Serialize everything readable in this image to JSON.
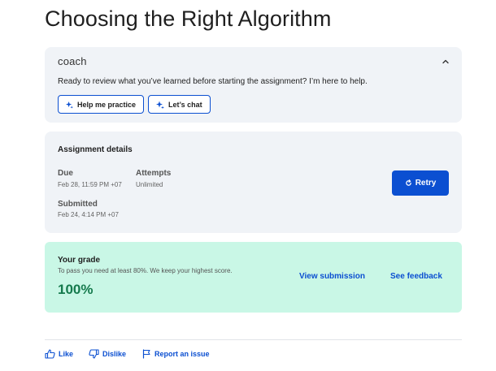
{
  "page": {
    "title": "Choosing the Right Algorithm"
  },
  "coach": {
    "title": "coach",
    "collapse_icon": "chevron-up-icon",
    "description": "Ready to review what you’ve learned before starting the assignment? I’m here to help.",
    "buttons": [
      {
        "label": "Help me practice",
        "icon": "sparkle-icon"
      },
      {
        "label": "Let’s chat",
        "icon": "sparkle-icon"
      }
    ]
  },
  "assignment": {
    "title": "Assignment details",
    "due_label": "Due",
    "due_value": "Feb 28, 11:59 PM +07",
    "attempts_label": "Attempts",
    "attempts_value": "Unlimited",
    "submitted_label": "Submitted",
    "submitted_value": "Feb 24, 4:14 PM +07",
    "retry_label": "Retry",
    "retry_icon": "refresh-icon"
  },
  "grade": {
    "title": "Your grade",
    "description": "To pass you need at least 80%. We keep your highest score.",
    "value": "100%",
    "view_submission_label": "View submission",
    "see_feedback_label": "See feedback"
  },
  "footer": {
    "like_label": "Like",
    "dislike_label": "Dislike",
    "report_label": "Report an issue"
  },
  "colors": {
    "accent": "#0b4fd1",
    "card_bg": "#f0f3f7",
    "grade_bg": "#c9f7e6",
    "grade_text": "#157a4d"
  }
}
